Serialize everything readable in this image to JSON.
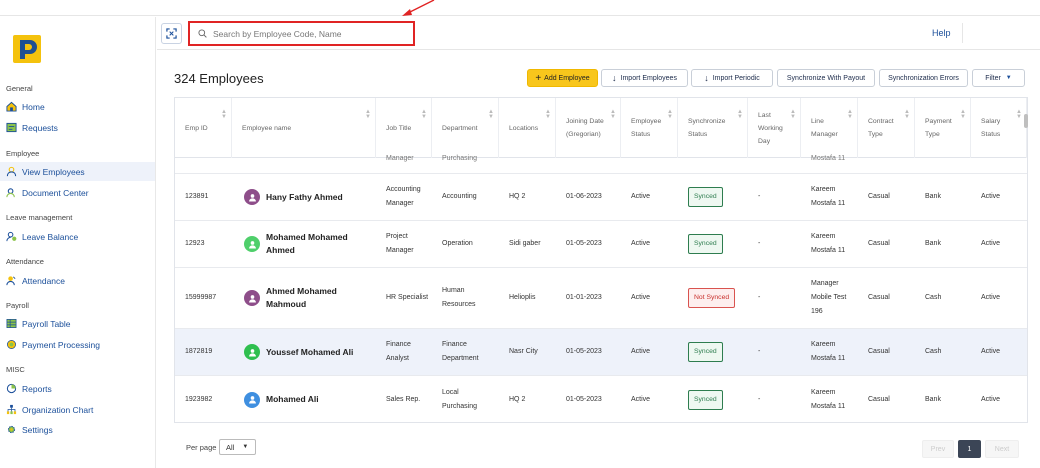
{
  "header": {
    "search_placeholder": "Search by Employee Code, Name",
    "help_label": "Help"
  },
  "sidebar": {
    "sections": [
      {
        "label": "General",
        "items": [
          {
            "label": "Home",
            "icon": "home-icon"
          },
          {
            "label": "Requests",
            "icon": "requests-icon"
          }
        ]
      },
      {
        "label": "Employee",
        "items": [
          {
            "label": "View Employees",
            "icon": "user-icon",
            "active": true
          },
          {
            "label": "Document Center",
            "icon": "document-user-icon"
          }
        ]
      },
      {
        "label": "Leave management",
        "items": [
          {
            "label": "Leave Balance",
            "icon": "leave-balance-icon"
          }
        ]
      },
      {
        "label": "Attendance",
        "items": [
          {
            "label": "Attendance",
            "icon": "attendance-icon"
          }
        ]
      },
      {
        "label": "Payroll",
        "items": [
          {
            "label": "Payroll Table",
            "icon": "payroll-table-icon"
          },
          {
            "label": "Payment Processing",
            "icon": "payment-icon"
          }
        ]
      },
      {
        "label": "MISC",
        "items": [
          {
            "label": "Reports",
            "icon": "reports-icon"
          },
          {
            "label": "Organization Chart",
            "icon": "org-chart-icon"
          },
          {
            "label": "Settings",
            "icon": "gear-icon"
          }
        ]
      }
    ]
  },
  "main": {
    "title": "324 Employees",
    "buttons": {
      "add": "Add Employee",
      "import_employees": "Import Employees",
      "import_periodic": "Import Periodic",
      "sync_payout": "Synchronize With Payout",
      "sync_errors": "Synchronization Errors",
      "filter": "Filter"
    },
    "columns": [
      "Emp ID",
      "Employee name",
      "Job Title",
      "Department",
      "Locations",
      "Joining Date (Gregorian)",
      "Employee Status",
      "Synchronize Status",
      "Last Working Day",
      "Line Manager",
      "Contract Type",
      "Payment Type",
      "Salary Status"
    ],
    "partial_row": {
      "job": "Manager",
      "dept": "Purchasing",
      "manager": "Mostafa 11"
    },
    "rows": [
      {
        "id": "123891",
        "name": "Hany Fathy Ahmed",
        "avatar_color": "#8e4e8a",
        "job": "Accounting Manager",
        "dept": "Accounting",
        "loc": "HQ 2",
        "date": "01-06-2023",
        "status": "Active",
        "sync": "Synced",
        "lwd": "-",
        "manager": "Kareem Mostafa 11",
        "contract": "Casual",
        "payment": "Bank",
        "salary": "Active"
      },
      {
        "id": "12923",
        "name": "Mohamed Mohamed Ahmed",
        "avatar_color": "#4fcf6b",
        "job": "Project Manager",
        "dept": "Operation",
        "loc": "Sidi gaber",
        "date": "01-05-2023",
        "status": "Active",
        "sync": "Synced",
        "lwd": "-",
        "manager": "Kareem Mostafa 11",
        "contract": "Casual",
        "payment": "Bank",
        "salary": "Active"
      },
      {
        "id": "15999987",
        "name": "Ahmed Mohamed Mahmoud",
        "avatar_color": "#8e4e8a",
        "job": "HR Specialist",
        "dept": "Human Resources",
        "loc": "Helioplis",
        "date": "01-01-2023",
        "status": "Active",
        "sync": "Not Synced",
        "lwd": "-",
        "manager": "Manager Mobile Test 196",
        "contract": "Casual",
        "payment": "Cash",
        "salary": "Active"
      },
      {
        "id": "1872819",
        "name": "Youssef Mohamed Ali",
        "avatar_color": "#2fbf4f",
        "job": "Finance Analyst",
        "dept": "Finance Department",
        "loc": "Nasr City",
        "date": "01-05-2023",
        "status": "Active",
        "sync": "Synced",
        "lwd": "-",
        "manager": "Kareem Mostafa 11",
        "contract": "Casual",
        "payment": "Cash",
        "salary": "Active"
      },
      {
        "id": "1923982",
        "name": "Mohamed Ali",
        "avatar_color": "#3f8fe0",
        "job": "Sales Rep.",
        "dept": "Local Purchasing",
        "loc": "HQ 2",
        "date": "01-05-2023",
        "status": "Active",
        "sync": "Synced",
        "lwd": "-",
        "manager": "Kareem Mostafa 11",
        "contract": "Casual",
        "payment": "Bank",
        "salary": "Active"
      }
    ]
  },
  "footer": {
    "per_page_label": "Per page",
    "per_page_value": "All",
    "prev": "Prev",
    "page": "1",
    "next": "Next"
  },
  "colors": {
    "accent": "#1b4f9a",
    "primary_button": "#f8c61c",
    "highlight": "#e02424"
  }
}
